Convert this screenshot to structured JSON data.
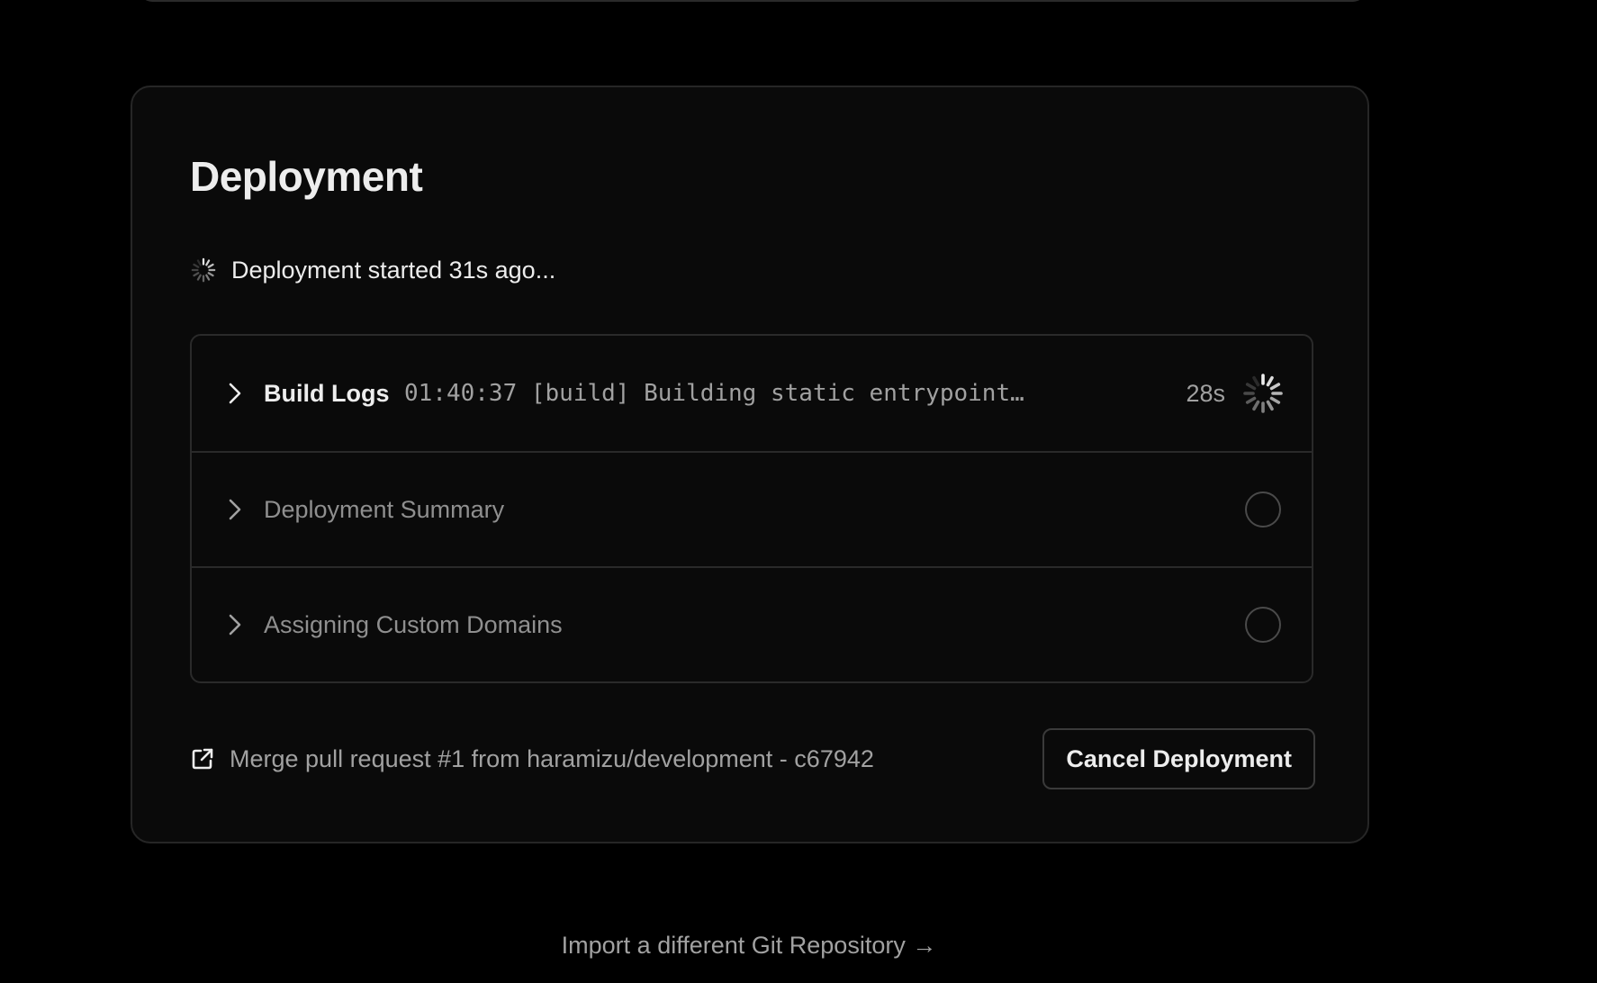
{
  "card": {
    "title": "Deployment",
    "status_text": "Deployment started 31s ago..."
  },
  "steps": [
    {
      "label": "Build Logs",
      "log_line": "01:40:37 [build] Building static entrypoint…",
      "duration": "28s",
      "state": "running"
    },
    {
      "label": "Deployment Summary",
      "state": "pending"
    },
    {
      "label": "Assigning Custom Domains",
      "state": "pending"
    }
  ],
  "footer": {
    "commit_text": "Merge pull request #1 from haramizu/development - c67942",
    "cancel_label": "Cancel Deployment"
  },
  "import_link": "Import a different Git Repository →",
  "colors": {
    "background": "#000000",
    "card": "#0a0a0a",
    "border": "#2a2a2a",
    "text_primary": "#ededed",
    "text_secondary": "#a1a1a1",
    "text_muted": "#8f8f8f"
  },
  "icons": {
    "status": "loading-spinner-icon",
    "chevron": "chevron-right-icon",
    "running": "loading-spinner-icon",
    "pending": "pending-circle-icon",
    "commit": "external-link-icon"
  }
}
